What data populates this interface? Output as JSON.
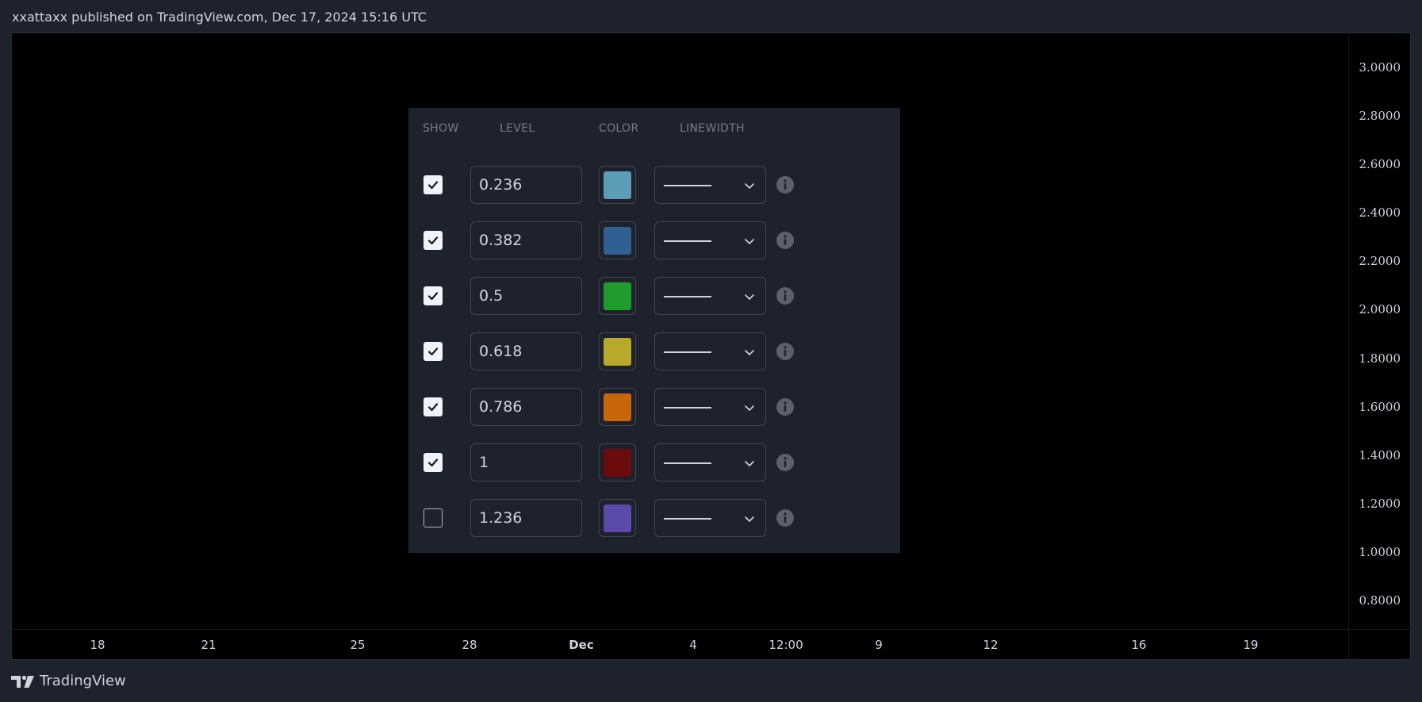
{
  "header": {
    "publish_text": "xxattaxx published on TradingView.com, Dec 17, 2024 15:16 UTC"
  },
  "chart": {
    "price_labels": [
      "3.0000",
      "2.8000",
      "2.6000",
      "2.4000",
      "2.2000",
      "2.0000",
      "1.8000",
      "1.6000",
      "1.4000",
      "1.2000",
      "1.0000",
      "0.8000"
    ],
    "time_labels": [
      {
        "label": "18",
        "bold": false
      },
      {
        "label": "21",
        "bold": false
      },
      {
        "label": "25",
        "bold": false
      },
      {
        "label": "28",
        "bold": false
      },
      {
        "label": "Dec",
        "bold": true
      },
      {
        "label": "4",
        "bold": false
      },
      {
        "label": "12:00",
        "bold": false
      },
      {
        "label": "9",
        "bold": false
      },
      {
        "label": "12",
        "bold": false
      },
      {
        "label": "16",
        "bold": false
      },
      {
        "label": "19",
        "bold": false
      }
    ]
  },
  "panel": {
    "columns": {
      "show": "SHOW",
      "level": "LEVEL",
      "color": "COLOR",
      "linewidth": "LINEWIDTH"
    },
    "rows": [
      {
        "checked": true,
        "level": "0.236",
        "color": "#5b9cb6"
      },
      {
        "checked": true,
        "level": "0.382",
        "color": "#315f91"
      },
      {
        "checked": true,
        "level": "0.5",
        "color": "#1f9d2c"
      },
      {
        "checked": true,
        "level": "0.618",
        "color": "#b8a92a"
      },
      {
        "checked": true,
        "level": "0.786",
        "color": "#c9650a"
      },
      {
        "checked": true,
        "level": "1",
        "color": "#6b0b0b"
      },
      {
        "checked": false,
        "level": "1.236",
        "color": "#5b4aa9"
      }
    ],
    "icons": {
      "check": "check-icon",
      "chevron": "chevron-down-icon",
      "info": "info-icon"
    }
  },
  "footer": {
    "brand": "TradingView",
    "logo_icon": "tradingview-logo-icon"
  }
}
